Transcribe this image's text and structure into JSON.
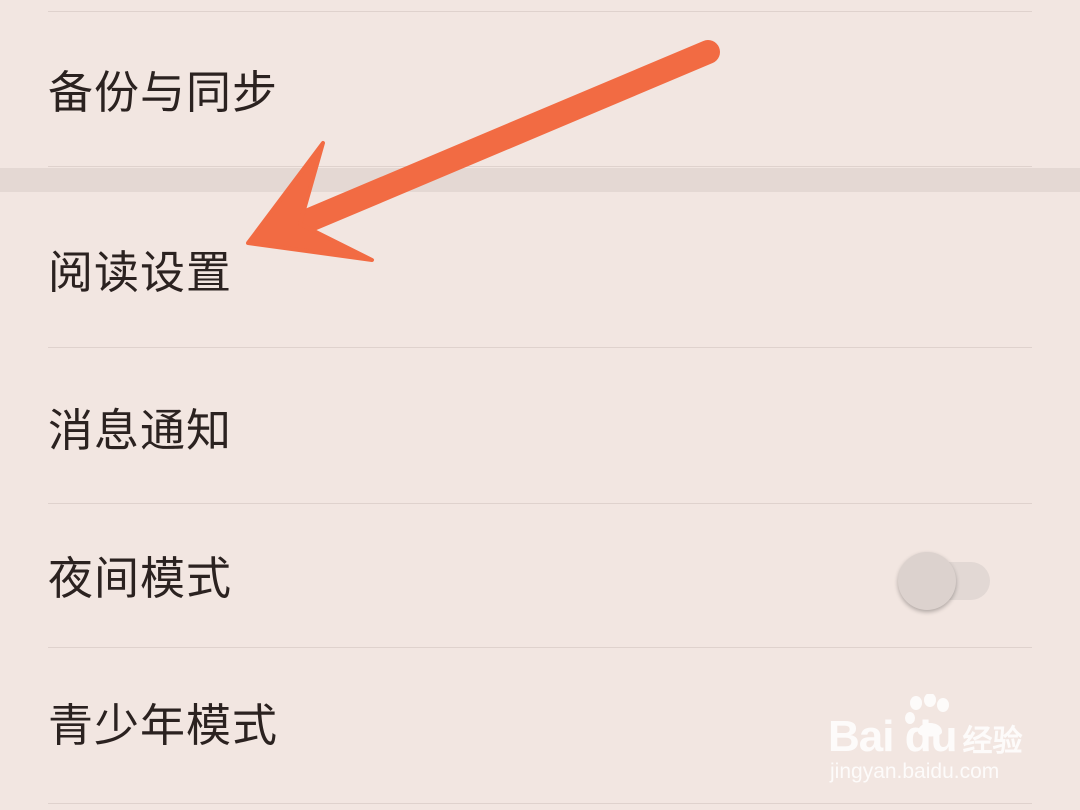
{
  "settings": {
    "items": [
      {
        "label": "备份与同步"
      },
      {
        "label": "阅读设置"
      },
      {
        "label": "消息通知"
      },
      {
        "label": "夜间模式",
        "toggle": {
          "on": false
        }
      },
      {
        "label": "青少年模式"
      }
    ]
  },
  "watermark": {
    "brand": "Bai du",
    "brand_cn": "经验",
    "url": "jingyan.baidu.com"
  },
  "colors": {
    "background": "#f2e6e1",
    "section_gap": "#e4d8d3",
    "divider": "#dfd2cd",
    "text": "#2b2220",
    "arrow": "#f26b43",
    "toggle_knob": "#dcd2ce",
    "toggle_track": "#e2d8d4"
  }
}
